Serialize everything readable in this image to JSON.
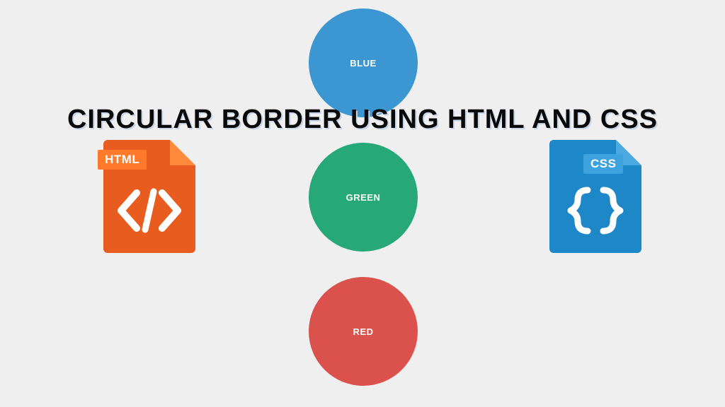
{
  "heading": "CIRCULAR BORDER USING HTML AND CSS",
  "circles": {
    "blue": {
      "label": "BLUE",
      "color": "#3b96d2"
    },
    "green": {
      "label": "GREEN",
      "color": "#27a879"
    },
    "red": {
      "label": "RED",
      "color": "#db524d"
    }
  },
  "icons": {
    "html": {
      "label": "HTML",
      "primary": "#e85d1f",
      "accent": "#ff7a2b"
    },
    "css": {
      "label": "CSS",
      "primary": "#1e87c8",
      "accent": "#3ea2df"
    }
  }
}
